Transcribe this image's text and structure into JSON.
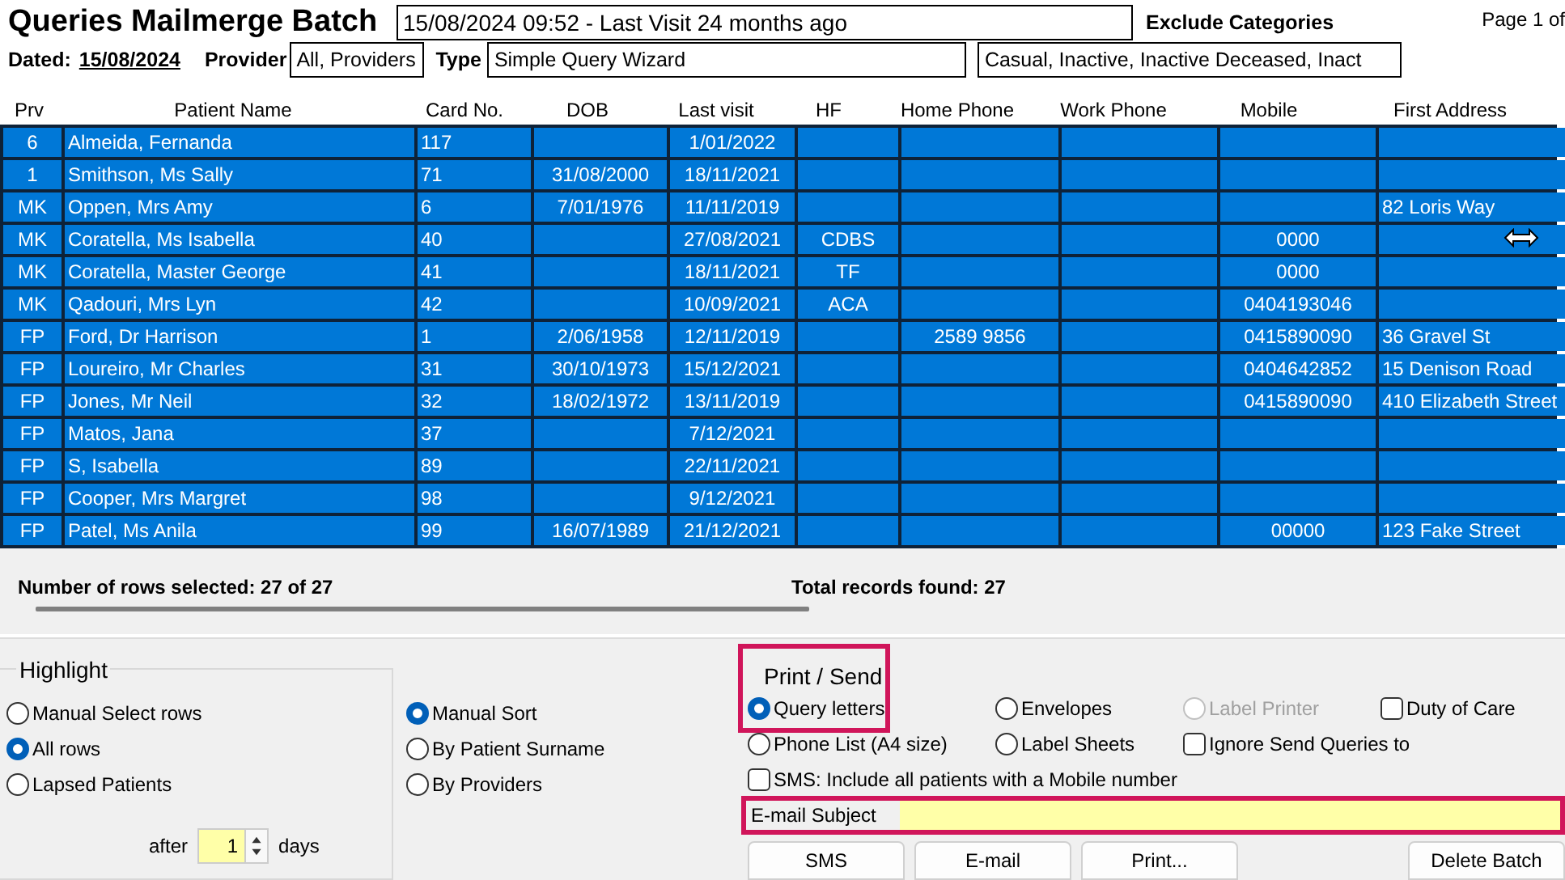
{
  "header": {
    "title": "Queries Mailmerge Batch",
    "visit_info": "15/08/2024 09:52 - Last Visit 24 months ago",
    "exclude_label": "Exclude Categories",
    "page_label": "Page 1 of",
    "dated_label": "Dated:",
    "dated_value": "15/08/2024",
    "provider_label": "Provider",
    "provider_value": "All,   Providers",
    "type_label": "Type",
    "type_value": "Simple Query Wizard",
    "exclude_value": "Casual, Inactive, Inactive Deceased, Inact"
  },
  "table": {
    "columns": [
      "Prv",
      "Patient Name",
      "Card No.",
      "DOB",
      "Last visit",
      "HF",
      "Home Phone",
      "Work Phone",
      "Mobile",
      "First Address"
    ],
    "rows": [
      {
        "selected": true,
        "cells": [
          "6",
          "Almeida,  Fernanda",
          "117",
          null,
          "1/01/2022",
          null,
          null,
          null,
          null,
          null
        ]
      },
      {
        "selected": true,
        "cells": [
          "1",
          "Smithson, Ms Sally",
          "71",
          "31/08/2000",
          "18/11/2021",
          null,
          null,
          null,
          null,
          null
        ]
      },
      {
        "selected": true,
        "cells": [
          "MK",
          "Oppen, Mrs Amy",
          "6",
          "7/01/1976",
          "11/11/2019",
          null,
          null,
          null,
          null,
          "82 Loris Way"
        ]
      },
      {
        "selected": true,
        "cells": [
          "MK",
          "Coratella, Ms Isabella",
          "40",
          null,
          "27/08/2021",
          "CDBS",
          null,
          null,
          "0000",
          null
        ]
      },
      {
        "selected": true,
        "cells": [
          "MK",
          "Coratella, Master George",
          "41",
          null,
          "18/11/2021",
          "TF",
          null,
          null,
          "0000",
          null
        ]
      },
      {
        "selected": true,
        "cells": [
          "MK",
          "Qadouri, Mrs Lyn",
          "42",
          null,
          "10/09/2021",
          "ACA",
          null,
          null,
          "0404193046",
          null
        ]
      },
      {
        "selected": true,
        "cells": [
          "FP",
          "Ford, Dr Harrison",
          "1",
          "2/06/1958",
          "12/11/2019",
          null,
          "2589 9856",
          null,
          "0415890090",
          "36 Gravel St"
        ]
      },
      {
        "selected": true,
        "cells": [
          "FP",
          "Loureiro, Mr Charles",
          "31",
          "30/10/1973",
          "15/12/2021",
          null,
          null,
          null,
          "0404642852",
          "15 Denison Road"
        ]
      },
      {
        "selected": true,
        "cells": [
          "FP",
          "Jones, Mr Neil",
          "32",
          "18/02/1972",
          "13/11/2019",
          null,
          null,
          null,
          "0415890090",
          "410 Elizabeth Street"
        ]
      },
      {
        "selected": true,
        "cells": [
          "FP",
          "Matos,  Jana",
          "37",
          null,
          "7/12/2021",
          null,
          null,
          null,
          null,
          null
        ]
      },
      {
        "selected": true,
        "cells": [
          "FP",
          "S,  Isabella",
          "89",
          null,
          "22/11/2021",
          null,
          null,
          null,
          null,
          null
        ]
      },
      {
        "selected": true,
        "cells": [
          "FP",
          "Cooper, Mrs Margret",
          "98",
          null,
          "9/12/2021",
          null,
          null,
          null,
          null,
          null
        ]
      },
      {
        "selected": true,
        "cells": [
          "FP",
          "Patel, Ms Anila",
          "99",
          "16/07/1989",
          "21/12/2021",
          null,
          null,
          null,
          "00000",
          "123 Fake Street"
        ]
      }
    ]
  },
  "status": {
    "rows_selected": "Number of rows selected: 27 of 27",
    "total_records": "Total records found: 27"
  },
  "highlight": {
    "title": "Highlight",
    "options": [
      {
        "label": "Manual Select rows",
        "selected": false
      },
      {
        "label": "All rows",
        "selected": true
      },
      {
        "label": "Lapsed Patients",
        "selected": false
      }
    ],
    "after_label": "after",
    "days_value": "1",
    "days_label": "days"
  },
  "sort": {
    "options": [
      {
        "label": "Manual Sort",
        "selected": true
      },
      {
        "label": "By Patient Surname",
        "selected": false
      },
      {
        "label": "By Providers",
        "selected": false
      }
    ]
  },
  "print_send": {
    "title": "Print / Send",
    "highlighted": true,
    "rows": [
      [
        {
          "kind": "radio",
          "label": "Query letters",
          "selected": true,
          "disabled": false
        },
        {
          "kind": "radio",
          "label": "Envelopes",
          "selected": false,
          "disabled": false
        },
        {
          "kind": "radio",
          "label": "Label Printer",
          "selected": false,
          "disabled": true
        },
        {
          "kind": "checkbox",
          "label": "Duty of Care",
          "checked": false,
          "disabled": false
        }
      ],
      [
        {
          "kind": "radio",
          "label": "Phone List (A4 size)",
          "selected": false,
          "disabled": false
        },
        {
          "kind": "radio",
          "label": "Label Sheets",
          "selected": false,
          "disabled": false
        },
        {
          "kind": "checkbox",
          "label": "Ignore Send Queries to",
          "checked": false,
          "disabled": false
        }
      ],
      [
        {
          "kind": "checkbox",
          "label": "SMS: Include all patients with a Mobile number",
          "checked": false,
          "disabled": false
        }
      ]
    ]
  },
  "email_subject": {
    "label": "E-mail Subject",
    "highlighted": true
  },
  "buttons": [
    "SMS",
    "E-mail",
    "Print...",
    "Delete Batch"
  ]
}
